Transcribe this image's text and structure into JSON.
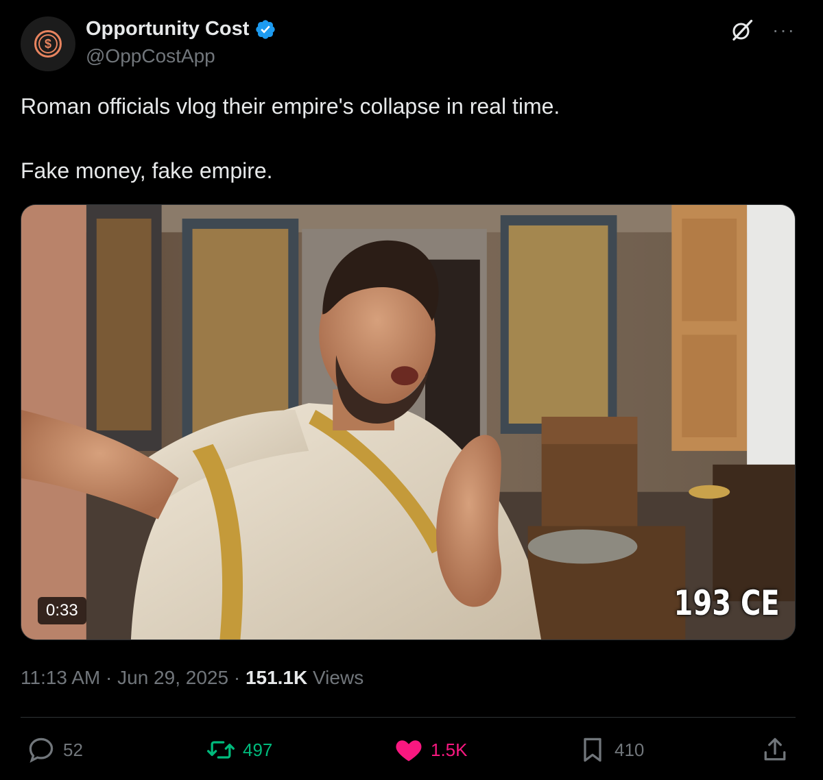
{
  "author": {
    "display_name": "Opportunity Cost",
    "handle": "@OppCostApp",
    "verified": true,
    "avatar_glyph": "$"
  },
  "tweet": {
    "paragraphs": [
      "Roman officials vlog their empire's collapse in real time.",
      "Fake money, fake empire."
    ]
  },
  "media": {
    "duration": "0:33",
    "caption": "193 CE"
  },
  "meta": {
    "time": "11:13 AM",
    "separator": "·",
    "date": "Jun 29, 2025",
    "views_count": "151.1K",
    "views_label": "Views"
  },
  "actions": {
    "replies": "52",
    "reposts": "497",
    "likes": "1.5K",
    "bookmarks": "410"
  },
  "colors": {
    "background": "#000000",
    "text": "#e7e9ea",
    "muted": "#71767b",
    "verified_blue": "#1d9bf0",
    "repost_green": "#00ba7c",
    "like_pink": "#f91880"
  }
}
